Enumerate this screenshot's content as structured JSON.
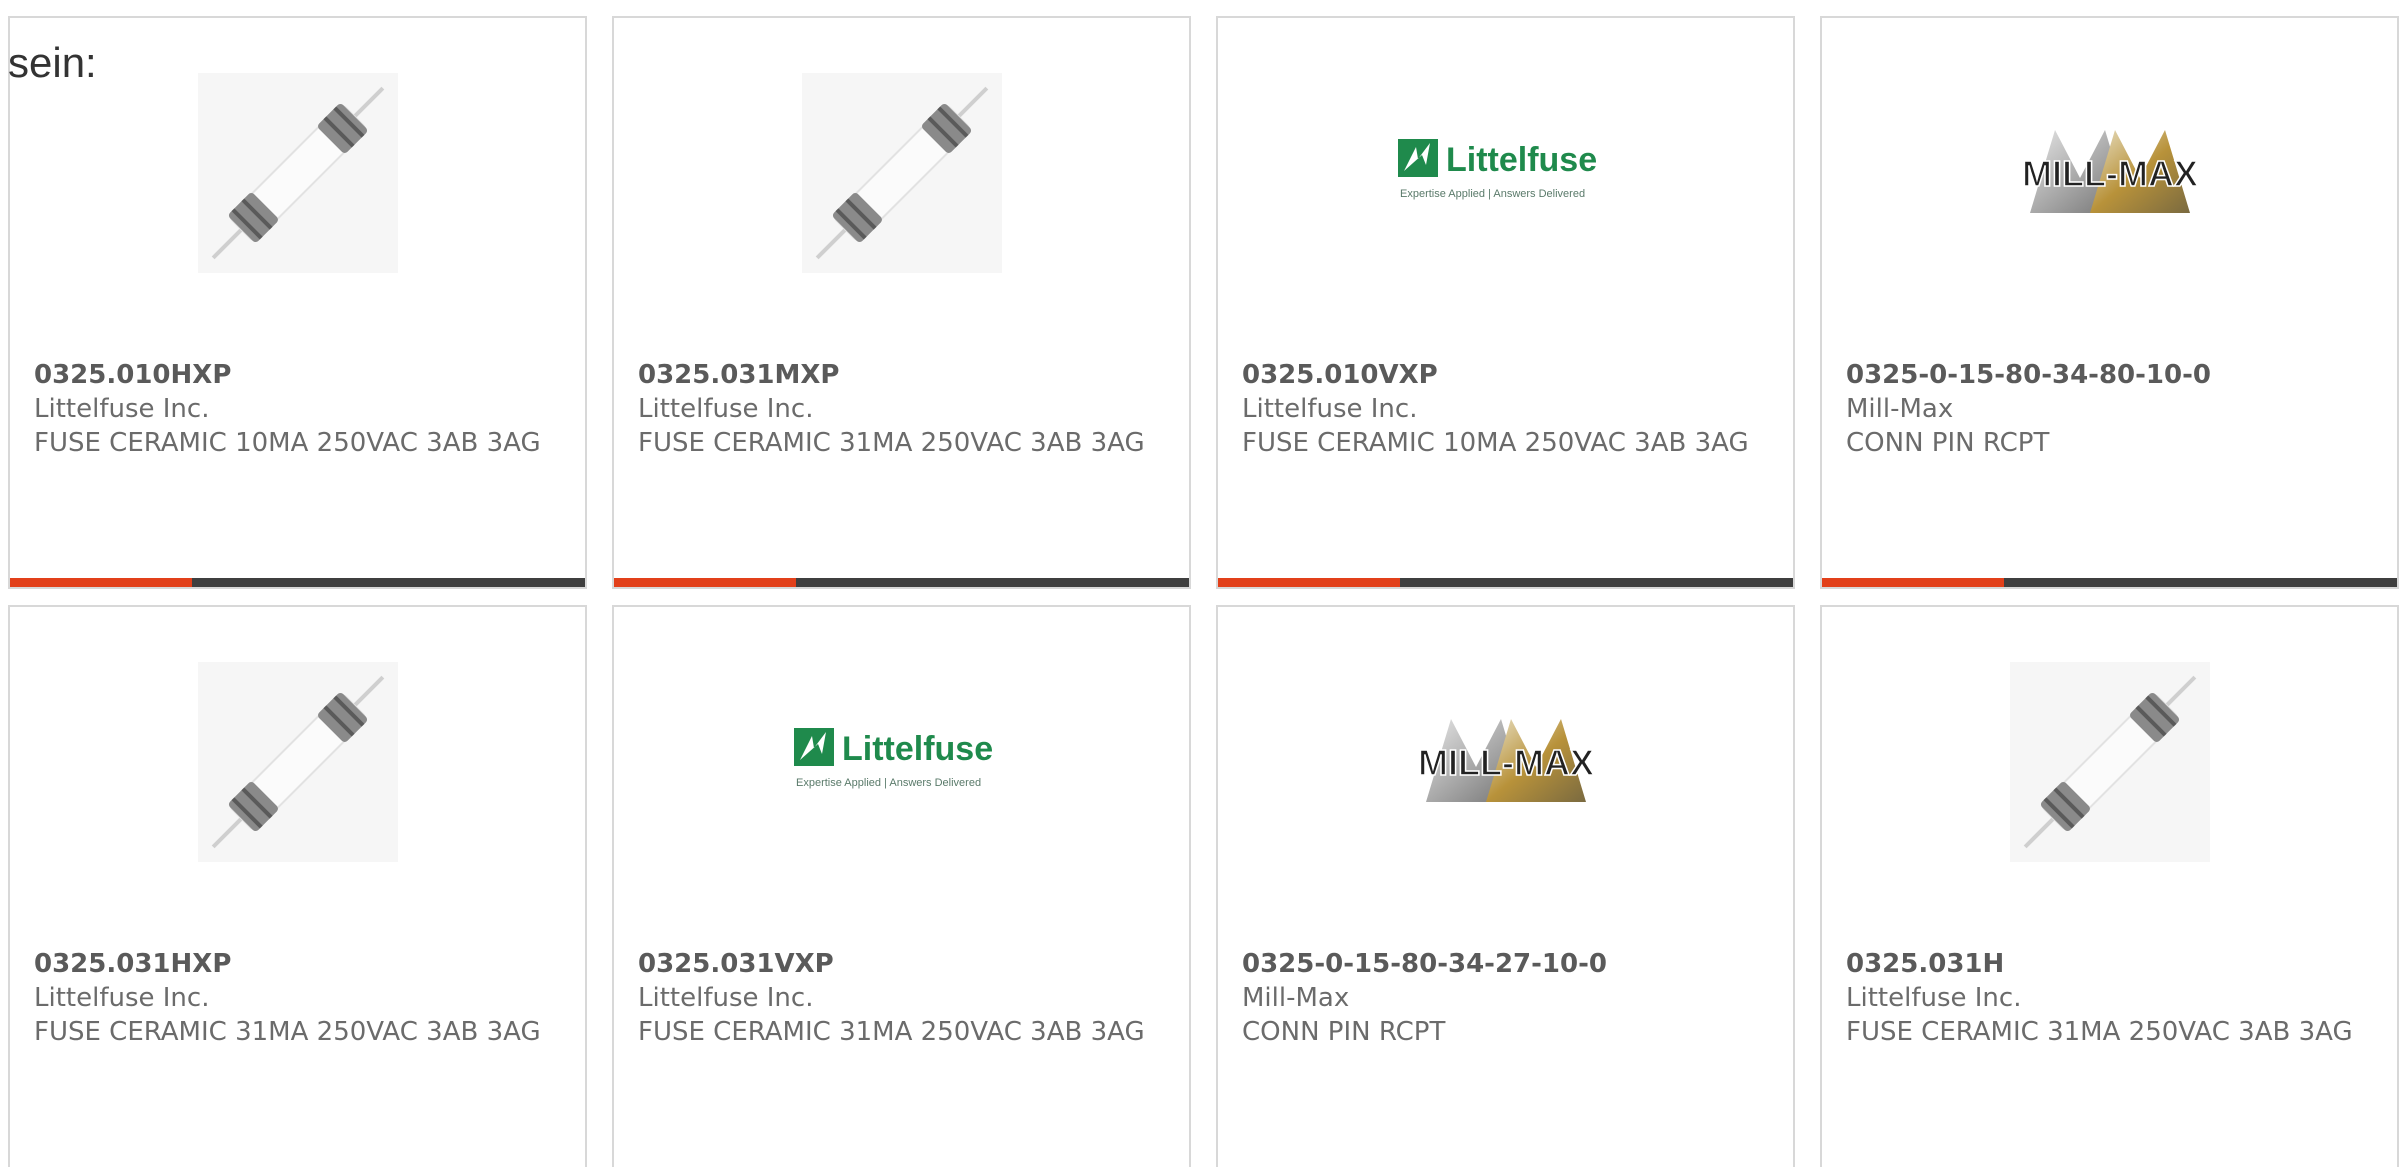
{
  "intro_text": "sein:",
  "colors": {
    "accent": "#e2401a",
    "bar": "#3f3f3f",
    "card_border": "#d8d8d8",
    "littelfuse_green": "#1f8a4c",
    "millmax_gold": "#b8923a"
  },
  "products": [
    {
      "part_number": "0325.010HXP",
      "manufacturer": "Littelfuse Inc.",
      "description": "FUSE CERAMIC 10MA 250VAC 3AB 3AG",
      "image": "fuse-photo"
    },
    {
      "part_number": "0325.031MXP",
      "manufacturer": "Littelfuse Inc.",
      "description": "FUSE CERAMIC 31MA 250VAC 3AB 3AG",
      "image": "fuse-photo"
    },
    {
      "part_number": "0325.010VXP",
      "manufacturer": "Littelfuse Inc.",
      "description": "FUSE CERAMIC 10MA 250VAC 3AB 3AG",
      "image": "littelfuse-logo"
    },
    {
      "part_number": "0325-0-15-80-34-80-10-0",
      "manufacturer": "Mill-Max",
      "description": "CONN PIN RCPT",
      "image": "millmax-logo"
    },
    {
      "part_number": "0325.031HXP",
      "manufacturer": "Littelfuse Inc.",
      "description": "FUSE CERAMIC 31MA 250VAC 3AB 3AG",
      "image": "fuse-photo"
    },
    {
      "part_number": "0325.031VXP",
      "manufacturer": "Littelfuse Inc.",
      "description": "FUSE CERAMIC 31MA 250VAC 3AB 3AG",
      "image": "littelfuse-logo"
    },
    {
      "part_number": "0325-0-15-80-34-27-10-0",
      "manufacturer": "Mill-Max",
      "description": "CONN PIN RCPT",
      "image": "millmax-logo"
    },
    {
      "part_number": "0325.031H",
      "manufacturer": "Littelfuse Inc.",
      "description": "FUSE CERAMIC 31MA 250VAC 3AB 3AG",
      "image": "fuse-photo"
    }
  ],
  "logos": {
    "littelfuse": {
      "name": "Littelfuse",
      "tagline": "Expertise Applied | Answers Delivered"
    },
    "millmax": {
      "name": "MILL-MAX"
    }
  }
}
